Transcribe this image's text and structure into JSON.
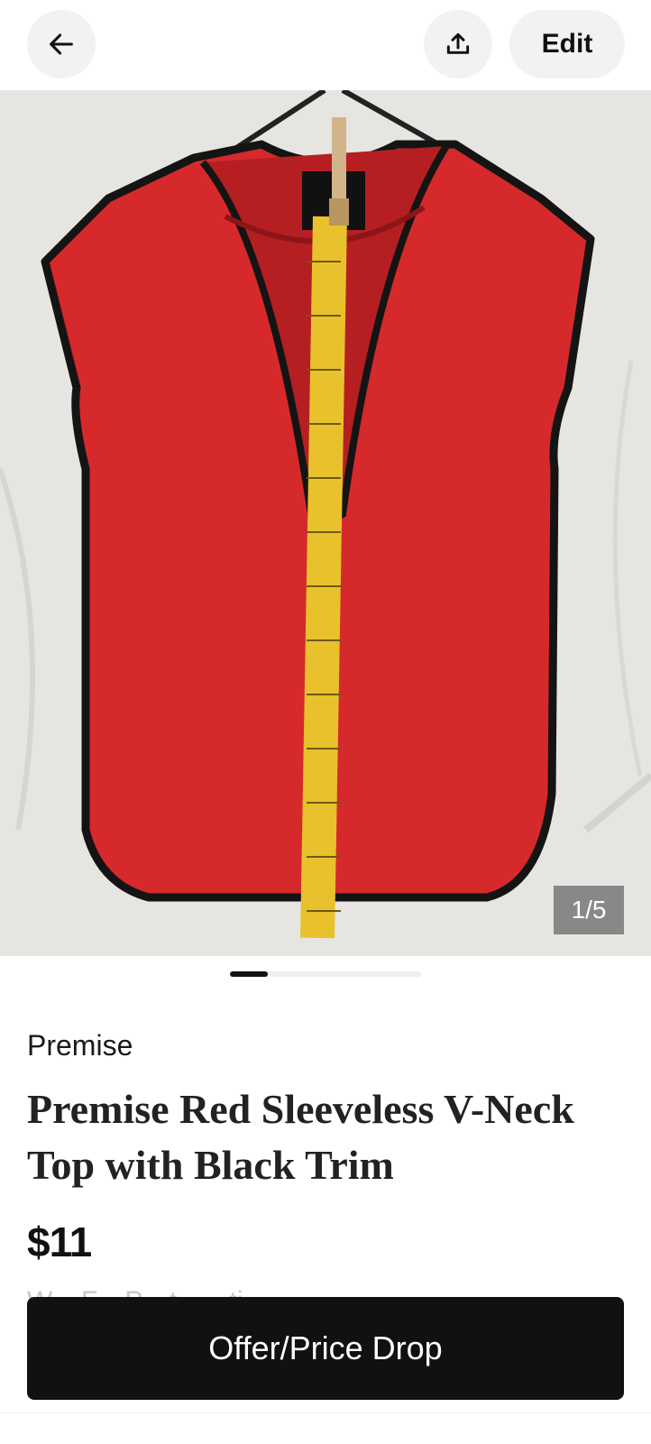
{
  "header": {
    "back_icon": "arrow-left-icon",
    "share_icon": "share-upload-icon",
    "edit_label": "Edit"
  },
  "gallery": {
    "counter": "1/5",
    "current_index": 1,
    "total": 5,
    "image_description_colors": {
      "garment": "#d6292b",
      "trim": "#161616",
      "tape": "#e9c12c",
      "background": "#e7e6e3"
    }
  },
  "listing": {
    "brand": "Premise",
    "title": "Premise Red Sleeveless V-Neck Top with Black Trim",
    "price": "$11",
    "partial_line": "W... F... P... t... ...ti..."
  },
  "cta": {
    "label": "Offer/Price Drop"
  }
}
